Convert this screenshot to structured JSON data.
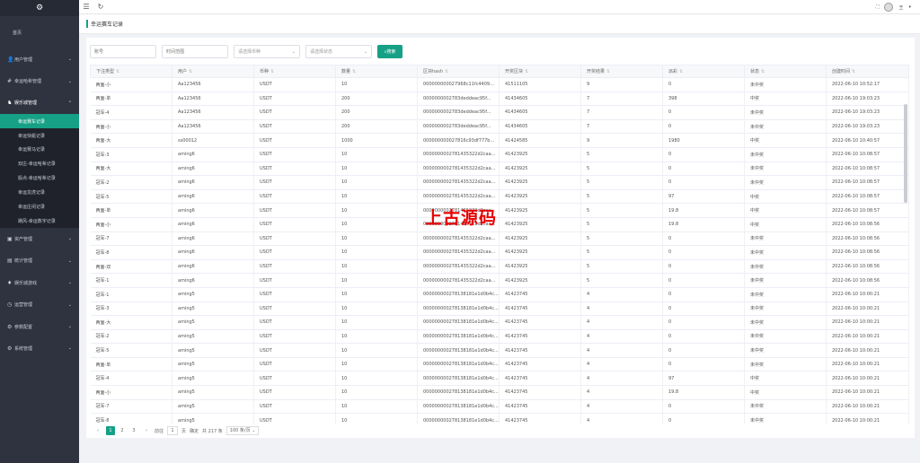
{
  "sidebar": {
    "home": "首页",
    "groups": [
      {
        "label": "用户管理",
        "open": false
      },
      {
        "label": "幸运哈希管理",
        "open": false
      },
      {
        "label": "娱乐城管理",
        "open": true,
        "items": [
          "幸运赛车记录",
          "幸运快艇记录",
          "幸运赛马记录",
          "双庄-幸运哈希记录",
          "骰点-幸运哈希记录",
          "幸运龙虎记录",
          "幸运庄闲记录",
          "飓风-幸运数字记录"
        ],
        "active": 0
      },
      {
        "label": "资产管理",
        "open": false
      },
      {
        "label": "统计管理",
        "open": false
      },
      {
        "label": "娱乐城游戏",
        "open": false
      },
      {
        "label": "运营管理",
        "open": false
      },
      {
        "label": "参数配置",
        "open": false
      },
      {
        "label": "系统管理",
        "open": false
      }
    ]
  },
  "topbar": {
    "menu_icon": "☰",
    "refresh_icon": "↻",
    "fullscreen_icon": "⛶",
    "user": "王",
    "caret": "▾"
  },
  "tab": {
    "title": "幸运赛车记录"
  },
  "filters": {
    "account_placeholder": "账号",
    "time_placeholder": "时间范围",
    "coin_placeholder": "请选择币种",
    "status_placeholder": "请选择状态",
    "search_label": "搜索"
  },
  "table": {
    "headers": [
      "下注类型",
      "用户",
      "币种",
      "数量",
      "区块hash",
      "开奖区块",
      "开奖结果",
      "派彩",
      "状态",
      "创建时间"
    ],
    "rows": [
      [
        "两面-小",
        "Aa123456",
        "USDT",
        "10",
        "000000000027968c11fc4409...",
        "41511105",
        "9",
        "0",
        "未中奖",
        "2022-06-10 10:52:17"
      ],
      [
        "两面-单",
        "Aa123456",
        "USDT",
        "200",
        "0000000002783deddeac95f...",
        "41434605",
        "7",
        "398",
        "中奖",
        "2022-06-10 19:03:23"
      ],
      [
        "冠军-4",
        "Aa123456",
        "USDT",
        "200",
        "0000000002783deddeac95f...",
        "41434605",
        "7",
        "0",
        "未中奖",
        "2022-06-10 19:03:23"
      ],
      [
        "两面-小",
        "Aa123456",
        "USDT",
        "200",
        "0000000002783deddeac95f...",
        "41434605",
        "7",
        "0",
        "未中奖",
        "2022-06-10 19:03:23"
      ],
      [
        "两面-大",
        "ss00012",
        "USDT",
        "1000",
        "000000000027816c93df777b...",
        "41424585",
        "9",
        "1980",
        "中奖",
        "2022-06-10 10:40:57"
      ],
      [
        "冠军-3",
        "aming6",
        "USDT",
        "10",
        "0000000002781435322d2caa...",
        "41423925",
        "5",
        "0",
        "未中奖",
        "2022-06-10 10:08:57"
      ],
      [
        "两面-大",
        "aming6",
        "USDT",
        "10",
        "0000000002781435322d2caa...",
        "41423925",
        "5",
        "0",
        "未中奖",
        "2022-06-10 10:08:57"
      ],
      [
        "冠军-2",
        "aming6",
        "USDT",
        "10",
        "0000000002781435322d2caa...",
        "41423925",
        "5",
        "0",
        "未中奖",
        "2022-06-10 10:08:57"
      ],
      [
        "冠军-5",
        "aming6",
        "USDT",
        "10",
        "0000000002781435322d2caa...",
        "41423925",
        "5",
        "97",
        "中奖",
        "2022-06-10 10:08:57"
      ],
      [
        "两面-单",
        "aming6",
        "USDT",
        "10",
        "0000000002781435322d2caa...",
        "41423925",
        "5",
        "19.8",
        "中奖",
        "2022-06-10 10:08:57"
      ],
      [
        "两面-小",
        "aming6",
        "USDT",
        "10",
        "0000000002781435322d2caa...",
        "41423925",
        "5",
        "19.8",
        "中奖",
        "2022-06-10 10:08:56"
      ],
      [
        "冠军-7",
        "aming6",
        "USDT",
        "10",
        "0000000002781435322d2caa...",
        "41423925",
        "5",
        "0",
        "未中奖",
        "2022-06-10 10:08:56"
      ],
      [
        "冠军-8",
        "aming6",
        "USDT",
        "10",
        "0000000002781435322d2caa...",
        "41423925",
        "5",
        "0",
        "未中奖",
        "2022-06-10 10:08:56"
      ],
      [
        "两面-双",
        "aming6",
        "USDT",
        "10",
        "0000000002781435322d2caa...",
        "41423925",
        "5",
        "0",
        "未中奖",
        "2022-06-10 10:08:56"
      ],
      [
        "冠军-1",
        "aming6",
        "USDT",
        "10",
        "0000000002781435322d2caa...",
        "41423925",
        "5",
        "0",
        "未中奖",
        "2022-06-10 10:08:56"
      ],
      [
        "冠军-1",
        "aming5",
        "USDT",
        "10",
        "000000000278138181e1d0b4c...",
        "41423745",
        "4",
        "0",
        "未中奖",
        "2022-06-10 10:00:21"
      ],
      [
        "冠军-3",
        "aming5",
        "USDT",
        "10",
        "000000000278138181e1d0b4c...",
        "41423745",
        "4",
        "0",
        "未中奖",
        "2022-06-10 10:00:21"
      ],
      [
        "两面-大",
        "aming5",
        "USDT",
        "10",
        "000000000278138181e1d0b4c...",
        "41423745",
        "4",
        "0",
        "未中奖",
        "2022-06-10 10:00:21"
      ],
      [
        "冠军-2",
        "aming5",
        "USDT",
        "10",
        "000000000278138181e1d0b4c...",
        "41423745",
        "4",
        "0",
        "未中奖",
        "2022-06-10 10:00:21"
      ],
      [
        "冠军-5",
        "aming5",
        "USDT",
        "10",
        "000000000278138181e1d0b4c...",
        "41423745",
        "4",
        "0",
        "未中奖",
        "2022-06-10 10:00:21"
      ],
      [
        "两面-单",
        "aming5",
        "USDT",
        "10",
        "000000000278138181e1d0b4c...",
        "41423745",
        "4",
        "0",
        "未中奖",
        "2022-06-10 10:00:21"
      ],
      [
        "冠军-4",
        "aming5",
        "USDT",
        "10",
        "000000000278138181e1d0b4c...",
        "41423745",
        "4",
        "97",
        "中奖",
        "2022-06-10 10:00:21"
      ],
      [
        "两面-小",
        "aming5",
        "USDT",
        "10",
        "000000000278138181e1d0b4c...",
        "41423745",
        "4",
        "19.8",
        "中奖",
        "2022-06-10 10:00:21"
      ],
      [
        "冠军-7",
        "aming5",
        "USDT",
        "10",
        "000000000278138181e1d0b4c...",
        "41423745",
        "4",
        "0",
        "未中奖",
        "2022-06-10 10:00:21"
      ],
      [
        "冠军-8",
        "aming5",
        "USDT",
        "10",
        "000000000278138181e1d0b4c...",
        "41423745",
        "4",
        "0",
        "未中奖",
        "2022-06-10 10:00:21"
      ]
    ]
  },
  "pager": {
    "pages": [
      "1",
      "2",
      "3"
    ],
    "current": "1",
    "goto_label": "前往",
    "goto_value": "1",
    "page_unit": "页",
    "confirm": "确定",
    "total": "共 217 条",
    "page_size": "100 条/页"
  },
  "watermark": "上古源码",
  "colors": {
    "accent": "#16a085",
    "sidebar_bg": "#2f3340",
    "watermark": "#e60000"
  }
}
